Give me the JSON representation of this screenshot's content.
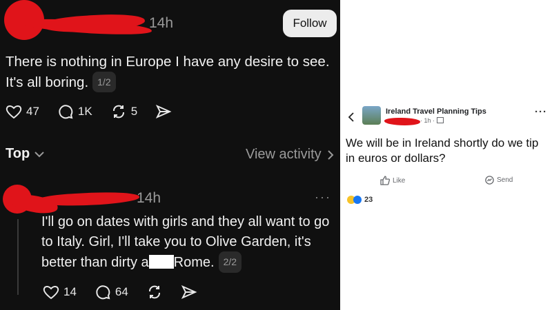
{
  "thread_post": {
    "time": "14h",
    "follow_label": "Follow",
    "text": "There is nothing in Europe I have any desire to see. It's all boring.",
    "page_indicator": "1/2",
    "likes": "47",
    "replies": "1K",
    "reposts": "5"
  },
  "replies_header": {
    "sort_label": "Top",
    "view_activity_label": "View activity"
  },
  "reply": {
    "time": "14h",
    "text_part1": "I'll go on dates with girls and they all want to go to Italy.  Girl, I'll take you to Olive Garden, it's better than dirty a",
    "text_part2": "Rome.",
    "page_indicator": "2/2",
    "likes": "14",
    "replies": "64"
  },
  "facebook_post": {
    "group_name": "Ireland Travel Planning Tips",
    "meta_time": "· 1h ·",
    "text": "We will be in Ireland shortly do we tip in euros or dollars?",
    "like_label": "Like",
    "send_label": "Send",
    "reactions_count": "23"
  },
  "colors": {
    "dark_bg": "#101010",
    "redaction": "#e0141a",
    "fb_like_blue": "#1877f2"
  }
}
